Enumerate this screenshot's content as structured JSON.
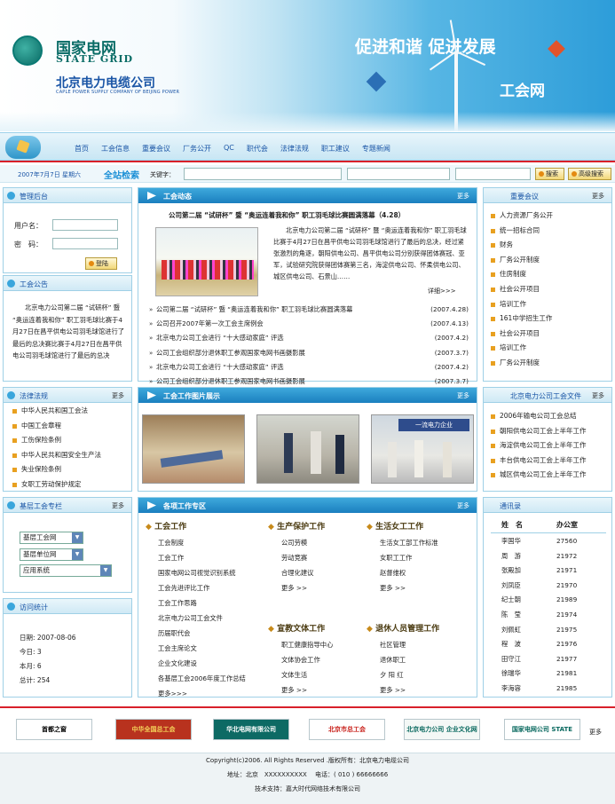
{
  "header": {
    "logo_cn": "国家电网",
    "logo_en": "STATE GRID",
    "company_cn": "北京电力电缆公司",
    "company_en": "CAPLE POWER SUPPLY COMPANY OF BEIJING POWER",
    "slogan": "促进和谐 促进发展",
    "site_name": "工会网"
  },
  "nav": {
    "items": [
      "首页",
      "工会信息",
      "重要会议",
      "厂务公开",
      "QC",
      "职代会",
      "法律法规",
      "职工建议",
      "专题新闻"
    ]
  },
  "search": {
    "date": "2007年7月7日 星期六",
    "title": "全站检索",
    "keyword_label": "关键字：",
    "search_btn": "搜索",
    "advanced_btn": "高级搜索"
  },
  "admin": {
    "title": "管理后台",
    "username_label": "用户名：",
    "password_label": "密　码：",
    "login_btn": "登陆"
  },
  "notice": {
    "title": "工会公告",
    "text": "北京电力公司第二届 “试研杯” 暨 “奥运连着我和你” 职工羽毛球比赛于4月27日在昌平供电公司羽毛球馆进行了最后的总决赛比赛于4月27日在昌平供电公司羽毛球馆进行了最后的总决"
  },
  "law": {
    "title": "法律法规",
    "more": "更多",
    "items": [
      "中华人民共和国工会法",
      "中国工会章程",
      "工伤保险条例",
      "中华人民共和国安全生产法",
      "失业保险条例",
      "女职工劳动保护规定"
    ]
  },
  "grassroots": {
    "title": "基层工会专栏",
    "more": "更多",
    "selects": [
      "基层工会网",
      "基层单位网",
      "应用系统"
    ]
  },
  "stats": {
    "title": "访问统计",
    "rows": [
      {
        "label": "日期:",
        "value": "2007-08-06"
      },
      {
        "label": "今日:",
        "value": "3"
      },
      {
        "label": "本月:",
        "value": "6"
      },
      {
        "label": "总计:",
        "value": "254"
      }
    ]
  },
  "dynamics": {
    "title": "工会动态",
    "more": "更多",
    "headline": "公司第二届 “试研杯” 暨 “奥运连着我和你” 职工羽毛球比赛圆满落幕（4.28）",
    "summary": "北京电力公司第二届 “试研杯” 暨 “奥运连着我和你” 职工羽毛球比赛于4月27日在昌平供电公司羽毛球馆进行了最后的总决，经过紧张激烈的角逐，朝阳供电公司、昌平供电公司分别获得团体赛冠、亚军，试验研究院获得团体赛第三名，海淀供电公司、怀柔供电公司、城区供电公司、石景山……",
    "detail": "详细>>>",
    "news": [
      {
        "t": "公司第二届 “试研杯” 暨 “奥运连着我和你” 职工羽毛球比赛圆满落幕",
        "d": "(2007.4.28)"
      },
      {
        "t": "公司召开2007年第一次工会主席例会",
        "d": "(2007.4.13)"
      },
      {
        "t": "北京电力公司工会进行 “十大感动家庭” 评选",
        "d": "(2007.4.2)"
      },
      {
        "t": "公司工会组织部分退休职工参观国家电网书画摄影展",
        "d": "(2007.3.7)"
      },
      {
        "t": "北京电力公司工会进行 “十大感动家庭” 评选",
        "d": "(2007.4.2)"
      },
      {
        "t": "公司工会组织部分退休职工参观国家电网书画摄影展",
        "d": "(2007.3.7)"
      }
    ]
  },
  "photos": {
    "title": "工会工作图片展示",
    "more": "更多",
    "photo3_text": "一流电力企业"
  },
  "work": {
    "title": "各项工作专区",
    "more": "更多",
    "columns": [
      {
        "title": "工会工作",
        "items": [
          "工会制度",
          "工会工作",
          "国家电网公司视觉识别系统",
          "工会先进评比工作",
          "工会工作思路",
          "北京电力公司工会文件",
          "历届职代会",
          "工会主席论文",
          "企业文化建设",
          "各基层工会2006年度工作总结"
        ],
        "more": "更多>>>"
      },
      {
        "title": "生产保护工作",
        "items": [
          "公司劳模",
          "劳动竞赛",
          "合理化建议"
        ],
        "more": "更多 >>"
      },
      {
        "title": "生活女工工作",
        "items": [
          "生活女工部工作标准",
          "女职工工作",
          "赵督维权"
        ],
        "more": "更多 >>"
      },
      {
        "title": "宣教文体工作",
        "items": [
          "职工健康指导中心",
          "文体协会工作",
          "文体生活"
        ],
        "more": "更多 >>"
      },
      {
        "title": "退休人员管理工作",
        "items": [
          "社区管理",
          "退休职工",
          "夕 阳 红"
        ],
        "more": "更多 >>"
      }
    ]
  },
  "meetings": {
    "title": "重要会议",
    "more": "更多",
    "items": [
      "人力资源厂务公开",
      "统一招标合同",
      "财务",
      "厂务公开制度",
      "住房制度",
      "社会公开项目",
      "培训工作",
      "161中学招生工作",
      "社会公开项目",
      "培训工作",
      "厂务公开制度"
    ]
  },
  "files": {
    "title": "北京电力公司工会文件",
    "more": "更多",
    "items": [
      "2006年输电公司工会总结",
      "朝阳供电公司工会上半年工作",
      "海淀供电公司工会上半年工作",
      "丰台供电公司工会上半年工作",
      "城区供电公司工会上半年工作"
    ]
  },
  "contacts": {
    "title": "通讯录",
    "col1": "姓　名",
    "col2": "办公室",
    "rows": [
      [
        "李国华",
        "27560"
      ],
      [
        "周　游",
        "21972"
      ],
      [
        "张殿加",
        "21971"
      ],
      [
        "刘凤臣",
        "21970"
      ],
      [
        "纪士朝",
        "21989"
      ],
      [
        "陈　莹",
        "21974"
      ],
      [
        "刘佩虹",
        "21975"
      ],
      [
        "程　波",
        "21976"
      ],
      [
        "田守江",
        "21977"
      ],
      [
        "徐瑞华",
        "21981"
      ],
      [
        "李海容",
        "21985"
      ]
    ]
  },
  "links": {
    "items": [
      "首都之窗 www.beijing.gov.cn",
      "中华全国总工会",
      "华北电网有限公司",
      "北京市总工会",
      "北京电力公司 企业文化网",
      "国家电网公司 STATE GRID"
    ],
    "more": "更多"
  },
  "footer": {
    "line1": "Copyright(c)2006. All Rights Reserved .版权所有：北京电力电缆公司",
    "line2": "地址：北京　XXXXXXXXXX　 电话：( 010 ) 66666666",
    "line3": "技术支持：嘉大时代网络技术有限公司"
  },
  "colors": {
    "accent": "#1a8fd6",
    "brand": "#0a6c66",
    "nav_text": "#1a55a6",
    "divider_red": "#d8202a",
    "bullet": "#e8a020"
  }
}
